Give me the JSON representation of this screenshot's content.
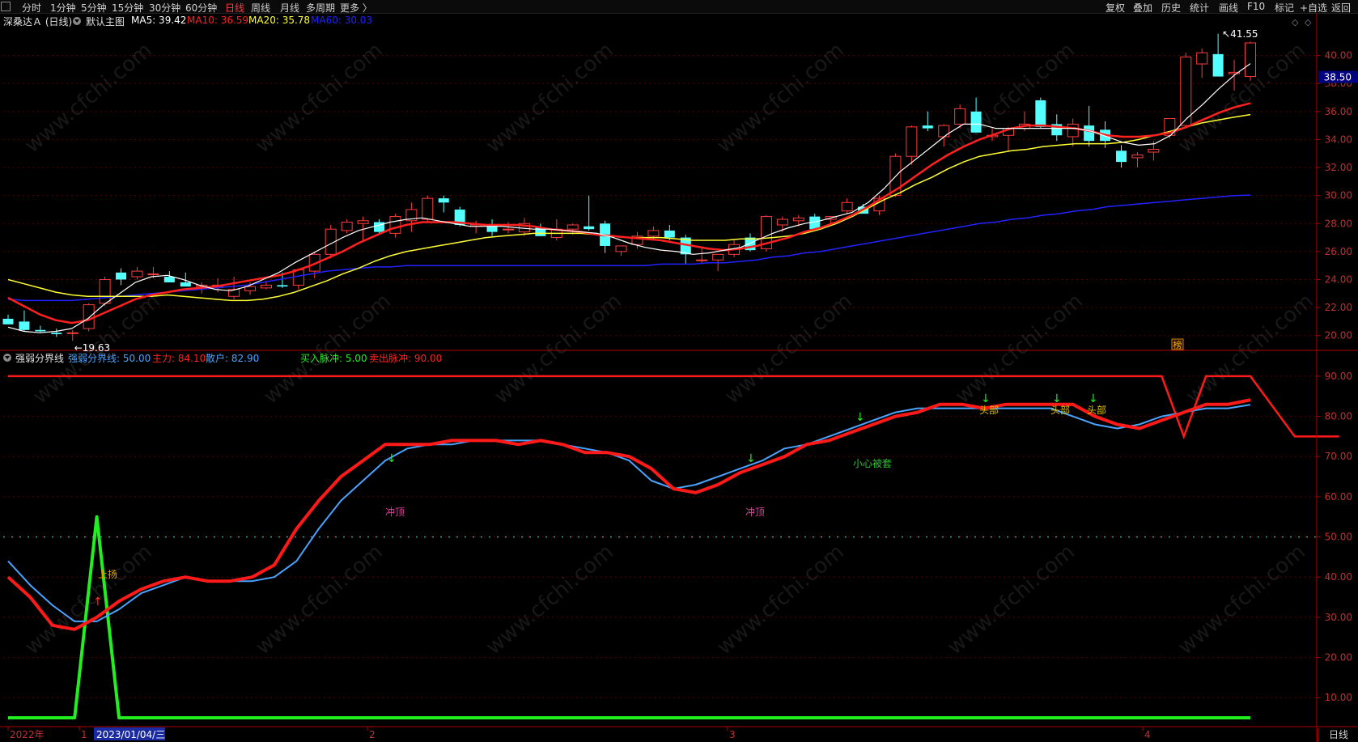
{
  "toolbar": {
    "left": [
      "分时",
      "1分钟",
      "5分钟",
      "15分钟",
      "30分钟",
      "60分钟",
      "日线",
      "周线",
      "月线",
      "多周期",
      "更多 〉"
    ],
    "active": "日线",
    "right": [
      "复权",
      "叠加",
      "历史",
      "统计",
      "画线",
      "F10",
      "标记",
      "+自选",
      "返回"
    ]
  },
  "main_legend": {
    "stock": "深桑达Ａ (日线)",
    "chart_name": "默认主图",
    "ma5": "MA5: 39.42",
    "ma10": "MA10: 36.59",
    "ma20": "MA20: 35.78",
    "ma60": "MA60: 30.03"
  },
  "sub_legend": {
    "name": "强弱分界线",
    "boundary": "强弱分界线: 50.00",
    "main_force": "主力: 84.10",
    "retail": "散户: 82.90",
    "buy_pulse": "买入脉冲: 5.00",
    "sell_pulse": "卖出脉冲: 90.00"
  },
  "annotations": {
    "high": "41.55",
    "low": "19.63",
    "price_tag": "38.50",
    "rank_badge": "榜",
    "rise": "上扬",
    "top1": "冲顶",
    "top2": "冲顶",
    "trap": "小心被套",
    "head": "头部"
  },
  "xaxis": {
    "labels": [
      "2022年",
      "1",
      "2",
      "3",
      "4"
    ],
    "cursor_date": "2023/01/04/三"
  },
  "period_button": "日线",
  "colors": {
    "up": "#ff3c3c",
    "down": "#54ffff",
    "ma5": "#ffffff",
    "ma10": "#ff2020",
    "ma20": "#ffff33",
    "ma60": "#2222ff",
    "main_force": "#ff1a1a",
    "retail": "#4aa3ff",
    "buy_pulse": "#22ee22",
    "sell_pulse": "#ff1a1a"
  },
  "chart_data": [
    {
      "type": "candlestick",
      "title": "默认主图",
      "ylim": [
        19,
        42
      ],
      "yticks": [
        20,
        22,
        24,
        26,
        28,
        30,
        32,
        34,
        36,
        38,
        40
      ],
      "candles": [
        [
          21.2,
          21.5,
          20.8,
          20.8
        ],
        [
          21.0,
          21.8,
          20.3,
          20.4
        ],
        [
          20.4,
          20.7,
          20.2,
          20.3
        ],
        [
          20.2,
          20.5,
          19.9,
          20.1
        ],
        [
          20.2,
          20.4,
          19.63,
          20.2
        ],
        [
          20.5,
          22.3,
          20.3,
          22.2
        ],
        [
          22.3,
          24.2,
          22.1,
          24.0
        ],
        [
          24.5,
          24.8,
          23.6,
          24.0
        ],
        [
          24.2,
          24.9,
          24.0,
          24.6
        ],
        [
          24.4,
          24.9,
          24.1,
          24.4
        ],
        [
          24.2,
          24.6,
          23.8,
          23.8
        ],
        [
          23.8,
          24.5,
          23.5,
          23.5
        ],
        [
          23.5,
          23.8,
          23.0,
          23.6
        ],
        [
          23.5,
          24.1,
          23.1,
          23.6
        ],
        [
          22.8,
          24.2,
          22.6,
          23.3
        ],
        [
          23.2,
          23.8,
          22.9,
          23.5
        ],
        [
          23.4,
          23.9,
          23.3,
          23.6
        ],
        [
          23.6,
          24.5,
          23.4,
          23.5
        ],
        [
          23.6,
          24.8,
          23.3,
          24.7
        ],
        [
          24.6,
          26.0,
          24.1,
          25.8
        ],
        [
          25.8,
          27.9,
          25.5,
          27.6
        ],
        [
          27.5,
          28.3,
          27.3,
          28.1
        ],
        [
          28.0,
          28.5,
          26.8,
          28.2
        ],
        [
          28.1,
          28.3,
          27.2,
          27.4
        ],
        [
          27.3,
          28.7,
          27.0,
          28.5
        ],
        [
          28.2,
          29.5,
          27.4,
          29.0
        ],
        [
          28.3,
          30.0,
          28.1,
          29.8
        ],
        [
          29.8,
          30.0,
          28.8,
          29.5
        ],
        [
          29.0,
          29.2,
          27.8,
          27.9
        ],
        [
          27.8,
          28.2,
          27.3,
          27.9
        ],
        [
          27.8,
          28.3,
          27.1,
          27.4
        ],
        [
          27.6,
          28.1,
          27.3,
          27.6
        ],
        [
          27.4,
          28.4,
          27.1,
          28.0
        ],
        [
          27.7,
          28.0,
          27.3,
          27.1
        ],
        [
          27.0,
          28.3,
          26.8,
          27.6
        ],
        [
          27.6,
          28.0,
          27.2,
          27.9
        ],
        [
          27.8,
          30.0,
          27.5,
          27.6
        ],
        [
          28.0,
          28.2,
          25.9,
          26.4
        ],
        [
          26.0,
          26.4,
          25.7,
          26.4
        ],
        [
          26.5,
          27.4,
          26.2,
          27.1
        ],
        [
          27.1,
          27.8,
          26.8,
          27.5
        ],
        [
          27.5,
          27.9,
          26.8,
          27.0
        ],
        [
          27.0,
          27.2,
          25.1,
          25.8
        ],
        [
          25.4,
          26.3,
          25.2,
          25.4
        ],
        [
          25.4,
          25.7,
          24.6,
          25.8
        ],
        [
          25.8,
          26.8,
          25.6,
          26.5
        ],
        [
          27.0,
          27.3,
          26.0,
          26.1
        ],
        [
          26.2,
          28.6,
          26.0,
          28.5
        ],
        [
          27.9,
          28.5,
          27.4,
          28.3
        ],
        [
          28.2,
          28.6,
          27.8,
          28.4
        ],
        [
          28.5,
          28.7,
          27.5,
          27.6
        ],
        [
          28.3,
          28.4,
          27.9,
          28.5
        ],
        [
          28.9,
          29.8,
          28.7,
          29.5
        ],
        [
          29.2,
          29.4,
          28.8,
          28.7
        ],
        [
          28.9,
          30.0,
          28.6,
          29.8
        ],
        [
          30.0,
          33.0,
          29.9,
          32.8
        ],
        [
          32.8,
          35.0,
          32.2,
          34.9
        ],
        [
          35.0,
          36.0,
          34.6,
          34.8
        ],
        [
          34.2,
          35.1,
          33.5,
          35.0
        ],
        [
          35.1,
          36.5,
          34.8,
          36.2
        ],
        [
          36.0,
          37.0,
          34.5,
          34.5
        ],
        [
          34.2,
          34.8,
          33.9,
          34.3
        ],
        [
          34.3,
          34.9,
          33.2,
          34.8
        ],
        [
          34.8,
          36.0,
          34.6,
          35.1
        ],
        [
          36.8,
          37.0,
          34.8,
          34.9
        ],
        [
          35.1,
          35.8,
          33.9,
          34.3
        ],
        [
          34.2,
          35.5,
          33.5,
          35.1
        ],
        [
          35.0,
          36.4,
          33.5,
          33.9
        ],
        [
          34.7,
          35.3,
          33.4,
          33.9
        ],
        [
          33.2,
          33.6,
          32.0,
          32.4
        ],
        [
          32.7,
          33.1,
          32.0,
          32.9
        ],
        [
          33.1,
          33.9,
          32.5,
          33.3
        ],
        [
          34.3,
          35.5,
          34.1,
          35.5
        ],
        [
          35.0,
          40.2,
          34.8,
          39.9
        ],
        [
          39.4,
          40.5,
          38.4,
          40.2
        ],
        [
          40.1,
          41.55,
          38.7,
          38.5
        ],
        [
          38.7,
          39.7,
          37.5,
          38.8
        ],
        [
          38.5,
          41.0,
          38.2,
          40.9
        ]
      ],
      "ma5": [
        20.6,
        20.3,
        20.2,
        20.3,
        20.5,
        21.2,
        22.2,
        23.0,
        23.8,
        24.2,
        24.3,
        24.0,
        23.6,
        23.3,
        23.2,
        23.5,
        24.0,
        24.5,
        25.2,
        25.8,
        26.4,
        27.0,
        27.5,
        27.8,
        28.1,
        28.3,
        28.4,
        28.2,
        28.0,
        27.8,
        27.8,
        27.8,
        27.7,
        27.6,
        27.6,
        27.5,
        27.4,
        27.3,
        27.0,
        26.6,
        26.3,
        26.1,
        26.0,
        25.8,
        25.9,
        26.1,
        26.3,
        26.8,
        27.3,
        27.7,
        28.0,
        28.2,
        28.5,
        28.8,
        29.5,
        30.5,
        31.7,
        32.6,
        33.5,
        34.4,
        35.1,
        35.1,
        34.8,
        34.8,
        34.8,
        34.8,
        34.8,
        34.8,
        34.6,
        34.2,
        33.8,
        33.6,
        33.7,
        34.3,
        35.5,
        36.5,
        37.6,
        38.6,
        39.42
      ],
      "ma10": [
        22.7,
        22.1,
        21.5,
        21.1,
        20.9,
        21.1,
        21.6,
        22.1,
        22.6,
        22.9,
        23.1,
        23.3,
        23.4,
        23.5,
        23.7,
        23.9,
        24.1,
        24.3,
        24.6,
        25.0,
        25.5,
        26.0,
        26.6,
        27.1,
        27.6,
        27.9,
        28.1,
        28.1,
        28.1,
        28.0,
        27.9,
        27.9,
        27.9,
        27.8,
        27.6,
        27.5,
        27.4,
        27.2,
        27.1,
        27.0,
        26.9,
        26.8,
        26.6,
        26.4,
        26.2,
        26.1,
        26.2,
        26.4,
        26.7,
        27.0,
        27.4,
        27.7,
        28.1,
        28.6,
        29.2,
        29.9,
        30.6,
        31.4,
        32.2,
        32.9,
        33.5,
        34.0,
        34.4,
        34.8,
        35.0,
        35.0,
        34.9,
        34.8,
        34.6,
        34.3,
        34.2,
        34.2,
        34.3,
        34.5,
        34.9,
        35.4,
        35.9,
        36.3,
        36.59
      ],
      "ma20": [
        24.0,
        23.7,
        23.4,
        23.1,
        22.9,
        22.8,
        22.8,
        22.8,
        22.8,
        22.8,
        22.9,
        22.8,
        22.7,
        22.6,
        22.5,
        22.5,
        22.6,
        22.8,
        23.1,
        23.5,
        23.9,
        24.4,
        24.8,
        25.3,
        25.7,
        26.0,
        26.2,
        26.4,
        26.6,
        26.8,
        27.0,
        27.1,
        27.2,
        27.3,
        27.3,
        27.3,
        27.3,
        27.2,
        27.1,
        27.0,
        27.0,
        27.0,
        26.9,
        26.8,
        26.8,
        26.8,
        26.9,
        26.9,
        27.0,
        27.1,
        27.3,
        27.6,
        28.0,
        28.5,
        29.1,
        29.7,
        30.2,
        30.8,
        31.3,
        31.9,
        32.4,
        32.8,
        33.0,
        33.2,
        33.3,
        33.5,
        33.6,
        33.7,
        33.7,
        33.7,
        33.8,
        34.0,
        34.3,
        34.6,
        34.9,
        35.2,
        35.4,
        35.6,
        35.78
      ],
      "ma60": [
        22.6,
        22.5,
        22.5,
        22.5,
        22.5,
        22.6,
        22.7,
        22.8,
        22.9,
        23.0,
        23.1,
        23.2,
        23.3,
        23.4,
        23.5,
        23.6,
        23.8,
        24.0,
        24.2,
        24.4,
        24.6,
        24.7,
        24.8,
        24.9,
        24.9,
        25.0,
        25.0,
        25.0,
        25.0,
        25.0,
        25.0,
        25.0,
        25.0,
        25.0,
        25.0,
        25.0,
        25.0,
        25.0,
        25.0,
        25.0,
        25.0,
        25.1,
        25.1,
        25.1,
        25.2,
        25.2,
        25.3,
        25.4,
        25.6,
        25.7,
        25.9,
        26.0,
        26.2,
        26.4,
        26.6,
        26.8,
        27.0,
        27.2,
        27.4,
        27.6,
        27.8,
        28.0,
        28.1,
        28.3,
        28.4,
        28.6,
        28.7,
        28.9,
        29.0,
        29.2,
        29.3,
        29.4,
        29.5,
        29.6,
        29.7,
        29.8,
        29.9,
        30.0,
        30.03
      ]
    },
    {
      "type": "line",
      "title": "强弱分界线",
      "ylim": [
        3,
        93
      ],
      "yticks": [
        10,
        20,
        30,
        40,
        50,
        60,
        70,
        80,
        90
      ],
      "boundary": 50,
      "main_force": [
        40,
        35,
        28,
        27,
        30,
        34,
        37,
        39,
        40,
        39,
        39,
        40,
        43,
        52,
        59,
        65,
        69,
        73,
        73,
        73,
        74,
        74,
        74,
        73,
        74,
        73,
        71,
        71,
        70,
        67,
        62,
        61,
        63,
        66,
        68,
        70,
        73,
        74,
        76,
        78,
        80,
        81,
        83,
        83,
        82,
        83,
        83,
        83,
        83,
        80,
        78,
        77,
        79,
        81,
        83,
        83,
        84.1
      ],
      "retail": [
        44,
        38,
        33,
        29,
        29,
        32,
        36,
        38,
        40,
        39,
        39,
        39,
        40,
        44,
        52,
        59,
        64,
        69,
        72,
        73,
        73,
        74,
        74,
        74,
        74,
        73,
        72,
        71,
        69,
        64,
        62,
        63,
        65,
        67,
        69,
        72,
        73,
        75,
        77,
        79,
        81,
        82,
        82,
        82,
        82,
        82,
        82,
        82,
        80,
        78,
        77,
        78,
        80,
        81,
        82,
        82,
        82.9
      ],
      "buy_pulse": [
        5,
        5,
        5,
        5,
        55,
        5,
        5,
        5,
        5,
        5,
        5,
        5,
        5,
        5,
        5,
        5,
        5,
        5,
        5,
        5,
        5,
        5,
        5,
        5,
        5,
        5,
        5,
        5,
        5,
        5,
        5,
        5,
        5,
        5,
        5,
        5,
        5,
        5,
        5,
        5,
        5,
        5,
        5,
        5,
        5,
        5,
        5,
        5,
        5,
        5,
        5,
        5,
        5,
        5,
        5,
        5,
        5
      ],
      "sell_pulse": [
        90,
        90,
        90,
        90,
        90,
        90,
        90,
        90,
        90,
        90,
        90,
        90,
        90,
        90,
        90,
        90,
        90,
        90,
        90,
        90,
        90,
        90,
        90,
        90,
        90,
        90,
        90,
        90,
        90,
        90,
        90,
        90,
        90,
        90,
        90,
        90,
        90,
        90,
        90,
        90,
        90,
        90,
        90,
        90,
        90,
        90,
        90,
        90,
        90,
        90,
        90,
        90,
        90,
        90,
        90,
        90,
        90
      ],
      "sell_dips": [
        [
          53,
          75
        ],
        [
          58,
          75
        ],
        [
          60,
          75
        ]
      ]
    }
  ]
}
